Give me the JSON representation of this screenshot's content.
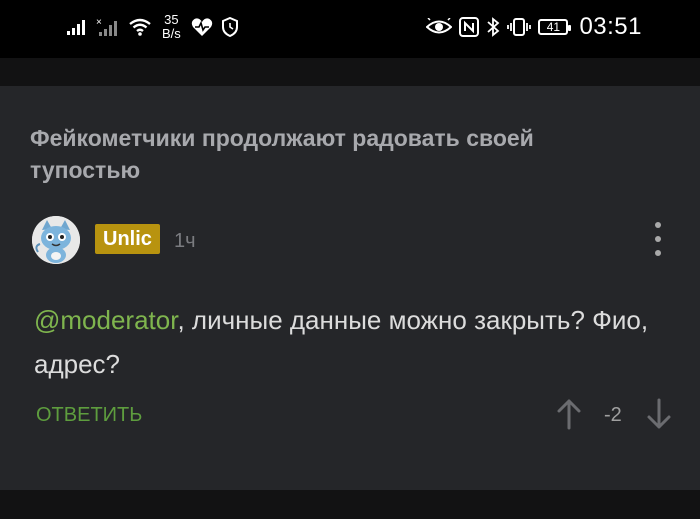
{
  "status_bar": {
    "signal_icons": [
      "signal-icon",
      "signal-no-sim-icon"
    ],
    "wifi_icon": "wifi-icon",
    "net_speed_value": "35",
    "net_speed_unit": "B/s",
    "health_icon": "heart-rate-icon",
    "shield_icon": "shield-icon",
    "eye_icon": "eye-comfort-icon",
    "nfc_icon": "nfc-icon",
    "bluetooth_icon": "bluetooth-icon",
    "vibrate_icon": "vibrate-icon",
    "battery": "41",
    "time": "03:51"
  },
  "post": {
    "title": "Фейкометчики продолжают радовать своей тупостью"
  },
  "comment": {
    "author": "Unlic",
    "time_ago": "1ч",
    "mention": "@moderator",
    "text": ", личные данные можно закрыть? Фио, адрес?",
    "reply_label": "ОТВЕТИТЬ",
    "score": "-2"
  },
  "colors": {
    "background": "#1b1c1e",
    "card": "#252629",
    "badge": "#b8930f",
    "mention": "#7fb54e",
    "reply": "#5e9d3e"
  }
}
